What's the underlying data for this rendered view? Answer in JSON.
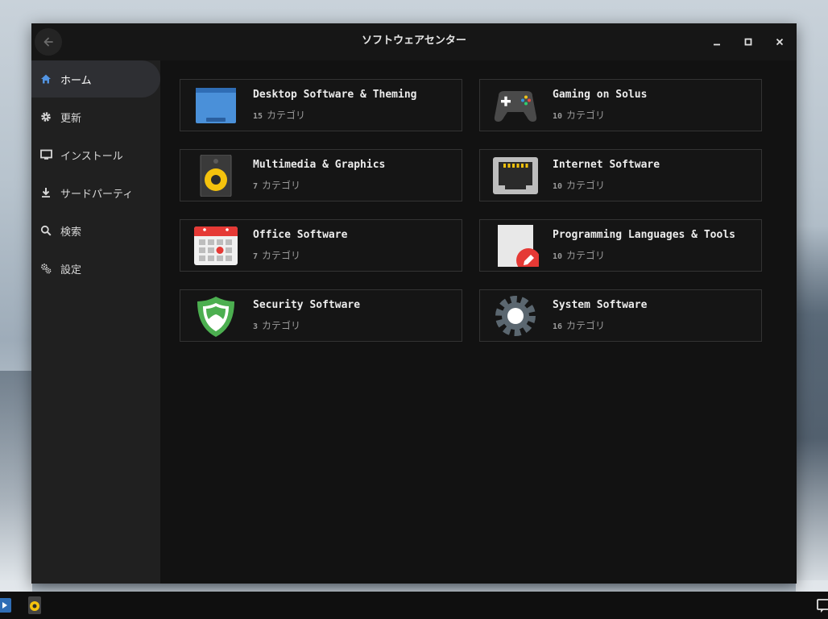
{
  "window": {
    "title": "ソフトウェアセンター"
  },
  "sidebar": {
    "items": [
      {
        "label": "ホーム",
        "icon": "home-icon",
        "active": true
      },
      {
        "label": "更新",
        "icon": "gear-icon",
        "active": false
      },
      {
        "label": "インストール",
        "icon": "monitor-icon",
        "active": false
      },
      {
        "label": "サードパーティ",
        "icon": "download-icon",
        "active": false
      },
      {
        "label": "検索",
        "icon": "search-icon",
        "active": false
      },
      {
        "label": "設定",
        "icon": "settings-icon",
        "active": false
      }
    ]
  },
  "categories": [
    {
      "title": "Desktop Software & Theming",
      "count": "15",
      "unit": "カテゴリ",
      "icon": "folder-icon"
    },
    {
      "title": "Gaming on Solus",
      "count": "10",
      "unit": "カテゴリ",
      "icon": "gamepad-icon"
    },
    {
      "title": "Multimedia & Graphics",
      "count": "7",
      "unit": "カテゴリ",
      "icon": "speaker-icon"
    },
    {
      "title": "Internet Software",
      "count": "10",
      "unit": "カテゴリ",
      "icon": "ethernet-port-icon"
    },
    {
      "title": "Office Software",
      "count": "7",
      "unit": "カテゴリ",
      "icon": "calendar-icon"
    },
    {
      "title": "Programming Languages & Tools",
      "count": "10",
      "unit": "カテゴリ",
      "icon": "document-edit-icon"
    },
    {
      "title": "Security Software",
      "count": "3",
      "unit": "カテゴリ",
      "icon": "shield-icon"
    },
    {
      "title": "System Software",
      "count": "16",
      "unit": "カテゴリ",
      "icon": "system-gear-icon"
    }
  ],
  "taskbar": {
    "items": [
      {
        "icon": "app-launcher-icon"
      },
      {
        "icon": "rhythmbox-speaker-icon"
      },
      {
        "icon": "notification-icon"
      }
    ]
  },
  "colors": {
    "window_bg": "#121212",
    "sidebar_bg": "#202020",
    "active_item_bg": "#2e2f33",
    "accent_blue": "#4a90d9"
  }
}
